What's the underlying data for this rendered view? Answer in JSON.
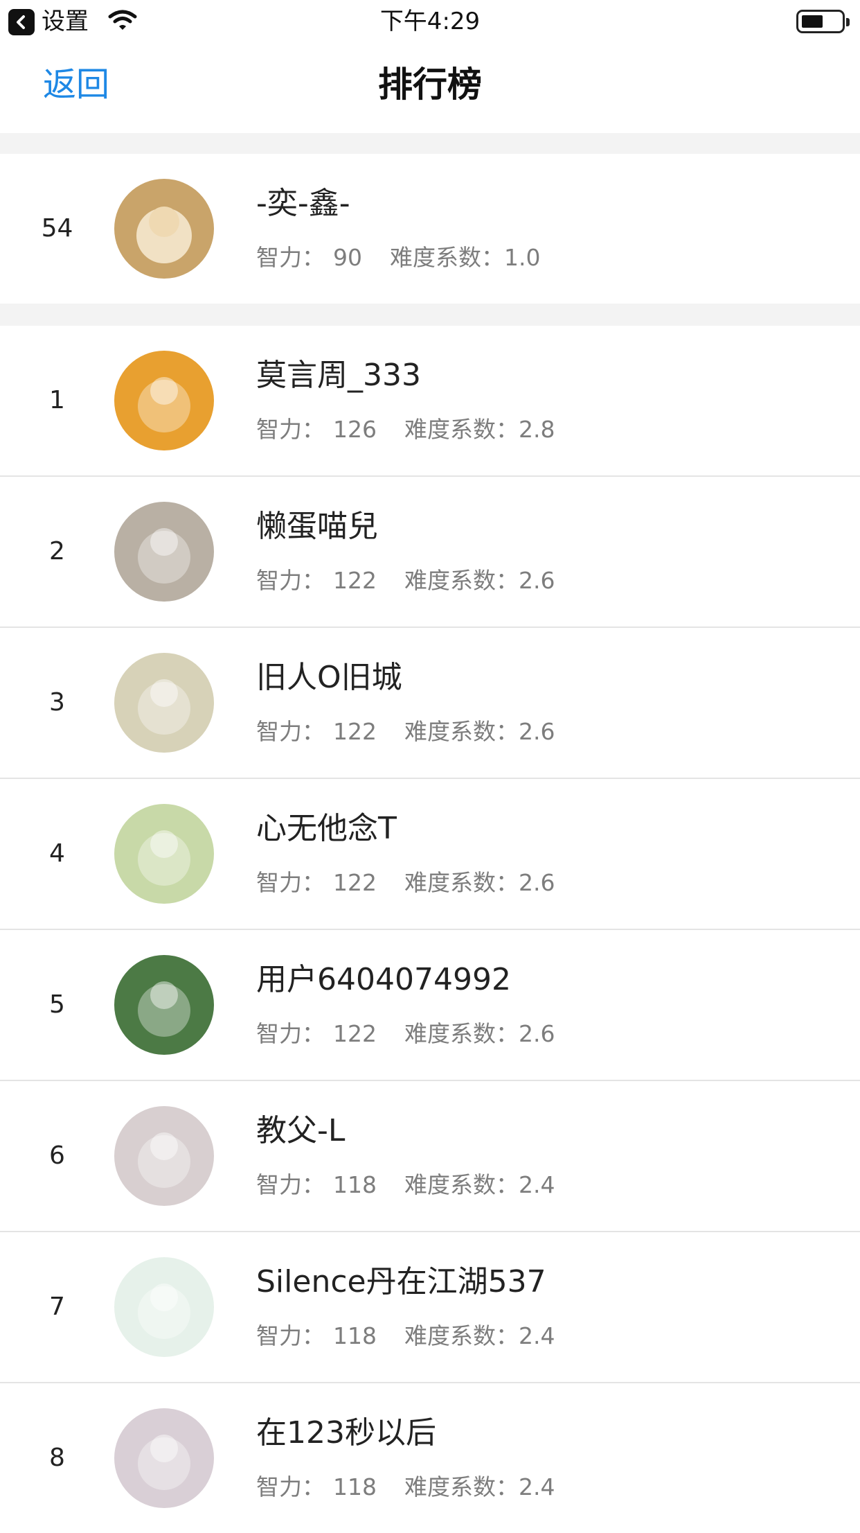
{
  "status_bar": {
    "back_app_label": "设置",
    "time": "下午4:29"
  },
  "nav": {
    "back_label": "返回",
    "title": "排行榜"
  },
  "labels": {
    "iq": "智力：",
    "difficulty": "难度系数："
  },
  "my_rank": {
    "rank": "54",
    "name": "-奕-鑫-",
    "iq": "90",
    "difficulty": "1.0"
  },
  "entries": [
    {
      "rank": "1",
      "name": "莫言周_333",
      "iq": "126",
      "difficulty": "2.8"
    },
    {
      "rank": "2",
      "name": "懒蛋喵兒",
      "iq": "122",
      "difficulty": "2.6"
    },
    {
      "rank": "3",
      "name": "旧人O旧城",
      "iq": "122",
      "difficulty": "2.6"
    },
    {
      "rank": "4",
      "name": "心无他念T",
      "iq": "122",
      "difficulty": "2.6"
    },
    {
      "rank": "5",
      "name": "用户6404074992",
      "iq": "122",
      "difficulty": "2.6"
    },
    {
      "rank": "6",
      "name": "教父-L",
      "iq": "118",
      "difficulty": "2.4"
    },
    {
      "rank": "7",
      "name": "Silence丹在江湖537",
      "iq": "118",
      "difficulty": "2.4"
    },
    {
      "rank": "8",
      "name": "在123秒以后",
      "iq": "118",
      "difficulty": "2.4"
    }
  ],
  "avatar_colors": [
    "#c9a46a",
    "#e8a030",
    "#b9b0a4",
    "#d7d2b8",
    "#c8d9a8",
    "#4c7a45",
    "#d8cfd0",
    "#e6f1ea",
    "#d9cfd6"
  ]
}
